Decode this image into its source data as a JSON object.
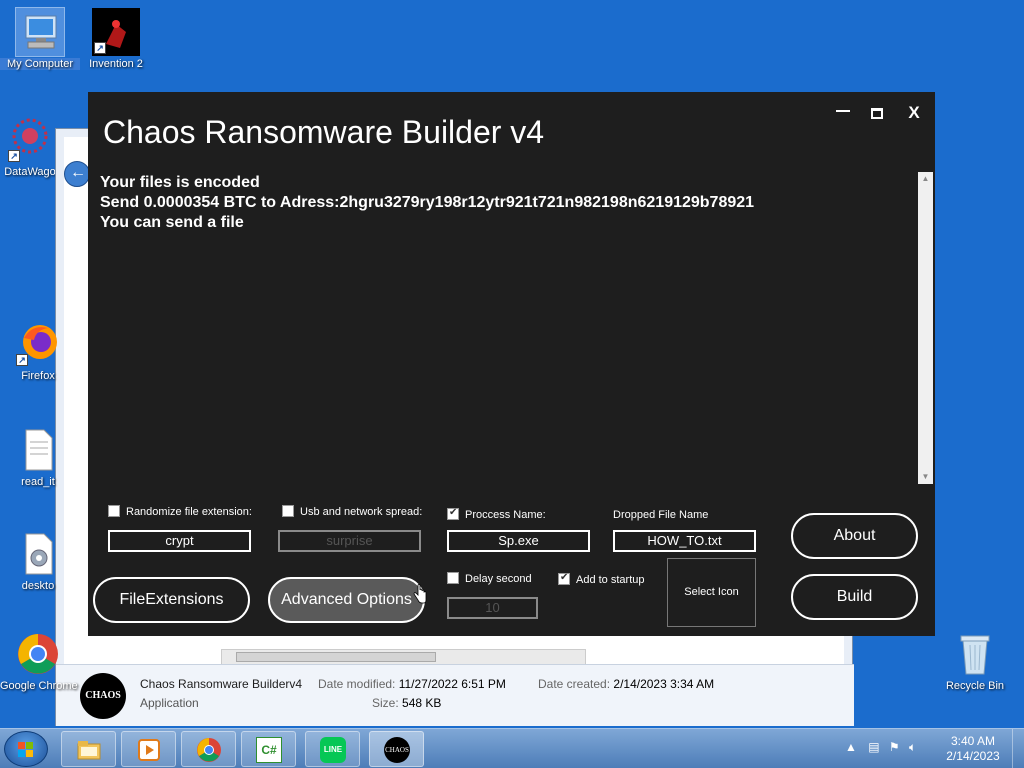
{
  "desktop": {
    "icons": [
      {
        "label": "My Computer",
        "icon": "computer-icon"
      },
      {
        "label": "Invention 2",
        "icon": "invention-icon"
      },
      {
        "label": "DataWago",
        "icon": "datawago-icon"
      },
      {
        "label": "Firefox",
        "icon": "firefox-icon"
      },
      {
        "label": "read_it",
        "icon": "text-file-icon"
      },
      {
        "label": "deskto",
        "icon": "settings-file-icon"
      },
      {
        "label": "Google Chrome",
        "icon": "chrome-icon"
      },
      {
        "label": "Recycle Bin",
        "icon": "recycle-bin-icon"
      }
    ]
  },
  "explorer": {
    "details": {
      "file_name": "Chaos Ransomware Builderv4",
      "file_type": "Application",
      "date_modified_label": "Date modified:",
      "date_modified": "11/27/2022 6:51 PM",
      "size_label": "Size:",
      "size": "548 KB",
      "date_created_label": "Date created:",
      "date_created": "2/14/2023 3:34 AM",
      "logo_text": "CHAOS"
    }
  },
  "builder": {
    "title": "Chaos Ransomware Builder v4",
    "window_controls": {
      "minimize": "minimize-icon",
      "maximize": "maximize-icon",
      "close": "X"
    },
    "note_lines": [
      "Your files is encoded",
      "Send 0.0000354 BTC to Adress:2hgru3279ry198r12ytr921t721n982198n6219129b78921",
      "You can send a file"
    ],
    "options": {
      "randomize_ext": {
        "label": "Randomize file extension:",
        "checked": false,
        "value": "crypt"
      },
      "usb_spread": {
        "label": "Usb and network spread:",
        "checked": false,
        "value": "surprise"
      },
      "process_name": {
        "label": "Proccess Name:",
        "checked": true,
        "value": "Sp.exe"
      },
      "dropped_file": {
        "label": "Dropped File Name",
        "value": "HOW_TO.txt"
      },
      "delay_second": {
        "label": "Delay second",
        "checked": false,
        "value": "10"
      },
      "add_startup": {
        "label": "Add to startup",
        "checked": true
      }
    },
    "buttons": {
      "file_extensions": "FileExtensions",
      "advanced_options": "Advanced Options",
      "select_icon": "Select Icon",
      "about": "About",
      "build": "Build"
    }
  },
  "taskbar": {
    "items": [
      "file-explorer-icon",
      "media-player-icon",
      "chrome-icon",
      "csharp-icon",
      "line-icon",
      "chaos-icon"
    ],
    "chaos_label": "CHAOS",
    "csharp_label": "C#",
    "line_label": "LINE",
    "clock_time": "3:40 AM",
    "clock_date": "2/14/2023"
  }
}
